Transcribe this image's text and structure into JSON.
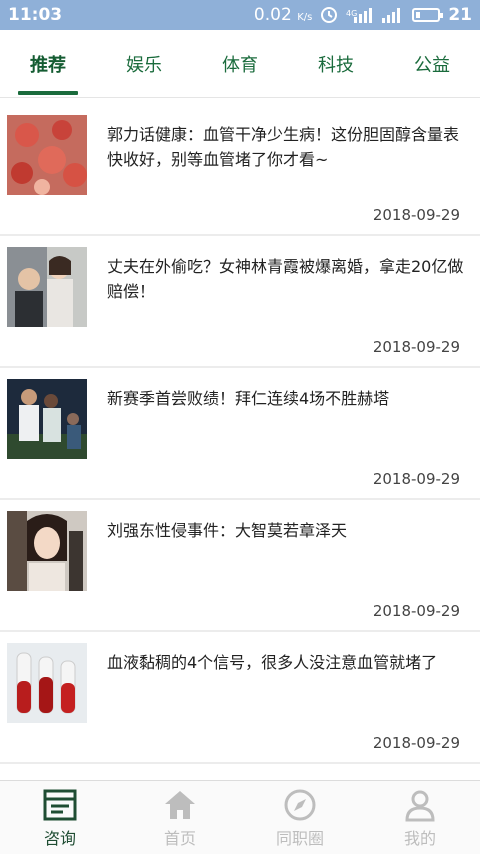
{
  "status_bar": {
    "time": "11:03",
    "speed": "0.02",
    "speed_unit": "K/s",
    "battery": "21",
    "battery_level": 0.21
  },
  "tabs": [
    {
      "label": "推荐",
      "active": true
    },
    {
      "label": "娱乐",
      "active": false
    },
    {
      "label": "体育",
      "active": false
    },
    {
      "label": "科技",
      "active": false
    },
    {
      "label": "公益",
      "active": false
    }
  ],
  "news": [
    {
      "title": "郭力话健康：血管干净少生病！这份胆固醇含量表快收好，别等血管堵了你才看~",
      "date": "2018-09-29",
      "thumb_icon": "blood-cells-photo"
    },
    {
      "title": "丈夫在外偷吃？女神林青霞被爆离婚，拿走20亿做赔偿！",
      "date": "2018-09-29",
      "thumb_icon": "couple-photo"
    },
    {
      "title": "新赛季首尝败绩！拜仁连续4场不胜赫塔",
      "date": "2018-09-29",
      "thumb_icon": "football-players-photo"
    },
    {
      "title": "刘强东性侵事件：大智莫若章泽天",
      "date": "2018-09-29",
      "thumb_icon": "woman-portrait-photo"
    },
    {
      "title": "血液黏稠的4个信号，很多人没注意血管就堵了",
      "date": "2018-09-29",
      "thumb_icon": "blood-test-tubes-photo"
    }
  ],
  "bottom_nav": [
    {
      "label": "咨询",
      "icon": "news-icon",
      "active": true
    },
    {
      "label": "首页",
      "icon": "home-icon",
      "active": false
    },
    {
      "label": "同职圈",
      "icon": "compass-icon",
      "active": false
    },
    {
      "label": "我的",
      "icon": "user-icon",
      "active": false
    }
  ],
  "colors": {
    "status_bar": "#8fb0d8",
    "accent": "#1a6b3c",
    "nav_inactive": "#bdbdbd"
  }
}
